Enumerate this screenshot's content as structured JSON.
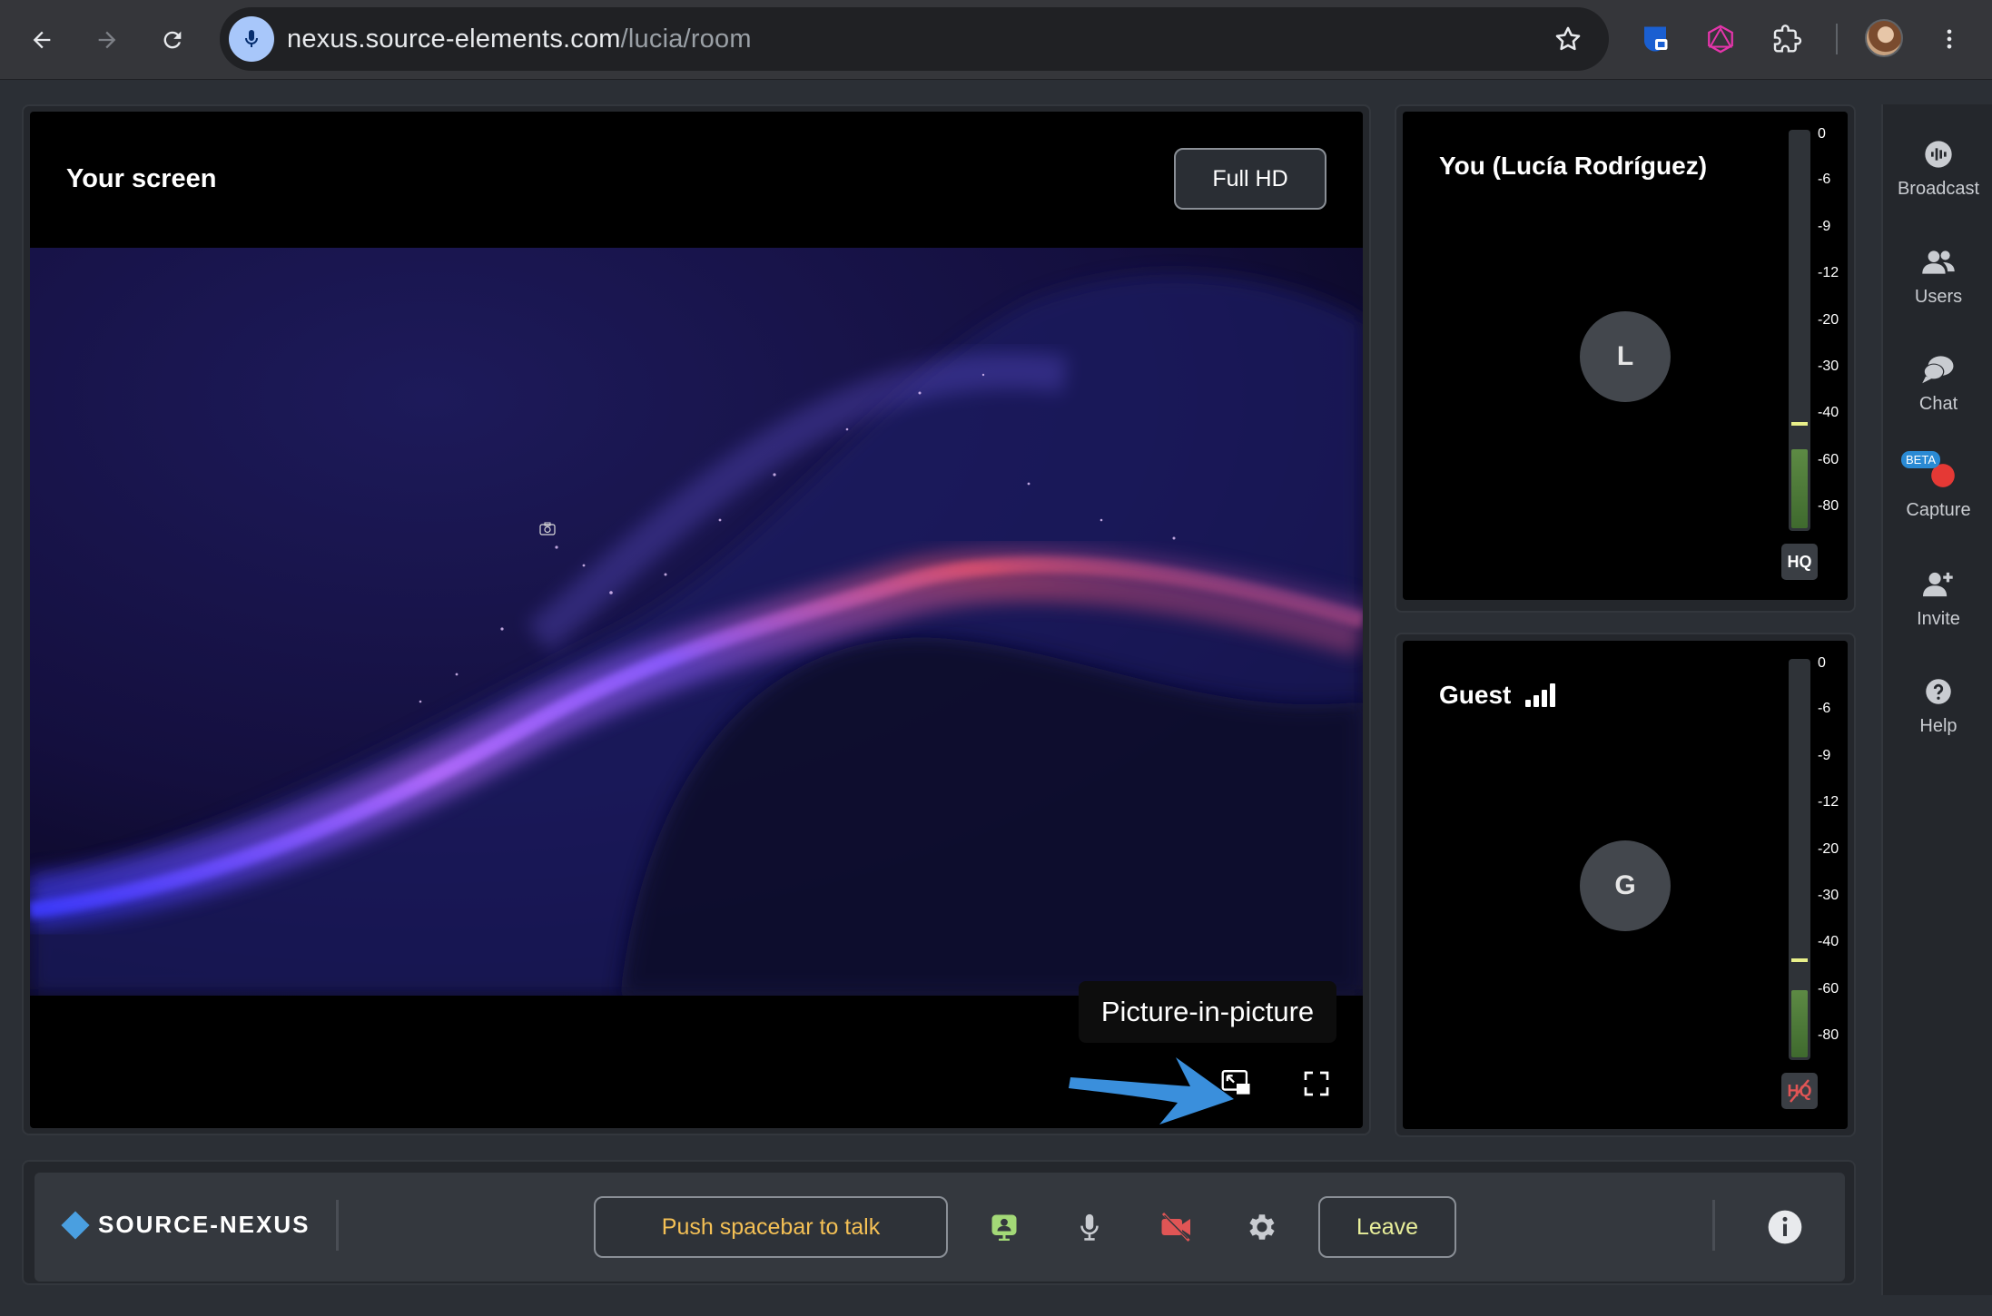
{
  "browser": {
    "url_host": "nexus.source-elements.com",
    "url_path": "/lucia/room",
    "icons": [
      "back-icon",
      "forward-icon",
      "reload-icon",
      "mic-icon",
      "star-icon",
      "password-extension-icon",
      "graphql-extension-icon",
      "puzzle-icon",
      "profile-avatar",
      "more-vert-icon"
    ]
  },
  "screen": {
    "title": "Your screen",
    "quality_button": "Full HD",
    "tooltip": "Picture-in-picture"
  },
  "participants": [
    {
      "name": "You (Lucía Rodríguez)",
      "initial": "L",
      "quality_badge": "HQ",
      "hq_enabled": true,
      "level_fraction": 0.2,
      "peak_fraction": 0.26
    },
    {
      "name": "Guest",
      "initial": "G",
      "quality_badge": "HQ",
      "hq_enabled": false,
      "level_fraction": 0.17,
      "peak_fraction": 0.24
    }
  ],
  "meter_scale": [
    "0",
    "-6",
    "-9",
    "-12",
    "-20",
    "-30",
    "-40",
    "-60",
    "-80"
  ],
  "sidebar": {
    "items": [
      {
        "label": "Broadcast",
        "icon": "broadcast-icon"
      },
      {
        "label": "Users",
        "icon": "users-icon"
      },
      {
        "label": "Chat",
        "icon": "chat-icon"
      },
      {
        "label": "Capture",
        "icon": "record-icon",
        "badge": "BETA"
      },
      {
        "label": "Invite",
        "icon": "add-user-icon"
      },
      {
        "label": "Help",
        "icon": "help-icon"
      }
    ]
  },
  "bottom": {
    "brand": "SOURCE-NEXUS",
    "push_to_talk": "Push spacebar to talk",
    "leave": "Leave"
  },
  "colors": {
    "accent_blue": "#4a9fe0",
    "ptt_text": "#f4c055",
    "leave_text": "#e9ef9b",
    "record_red": "#e53935",
    "camera_off_red": "#e05555",
    "presenter_green": "#a3d977"
  }
}
